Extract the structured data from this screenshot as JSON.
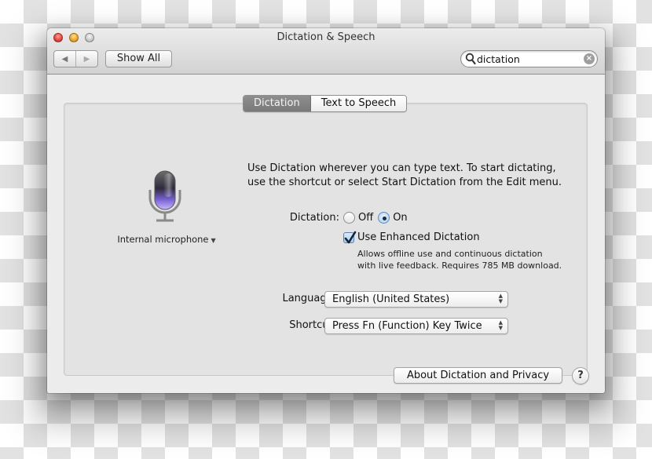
{
  "window": {
    "title": "Dictation & Speech"
  },
  "toolbar": {
    "back_icon": "triangle-left",
    "forward_icon": "triangle-right",
    "show_all_label": "Show All",
    "search": {
      "value": "dictation",
      "placeholder": "",
      "search_icon": "magnifier",
      "clear_icon": "x-circle"
    }
  },
  "tabs": [
    {
      "label": "Dictation",
      "active": true
    },
    {
      "label": "Text to Speech",
      "active": false
    }
  ],
  "microphone": {
    "icon": "microphone",
    "input_source": "Internal microphone",
    "caret": "▼"
  },
  "description": {
    "line1": "Use Dictation wherever you can type text. To start dictating,",
    "line2": "use the shortcut or select Start Dictation from the Edit menu."
  },
  "dictation": {
    "label": "Dictation:",
    "options": [
      {
        "label": "Off",
        "selected": false
      },
      {
        "label": "On",
        "selected": true
      }
    ]
  },
  "enhanced": {
    "label": "Use Enhanced Dictation",
    "checked": true,
    "note_line1": "Allows offline use and continuous dictation",
    "note_line2": "with live feedback. Requires 785 MB download."
  },
  "language": {
    "label": "Language:",
    "value": "English (United States)"
  },
  "shortcut": {
    "label": "Shortcut:",
    "value": "Press Fn (Function) Key Twice"
  },
  "footer": {
    "about_label": "About Dictation and Privacy",
    "help_label": "?"
  },
  "colors": {
    "active_tab": "#858585",
    "close": "#e0443e",
    "minimize": "#e8a42a",
    "zoom": "#c8c8c8",
    "radio_selected": "#a9cdf0",
    "mic_glow": "#8a6ee0"
  }
}
